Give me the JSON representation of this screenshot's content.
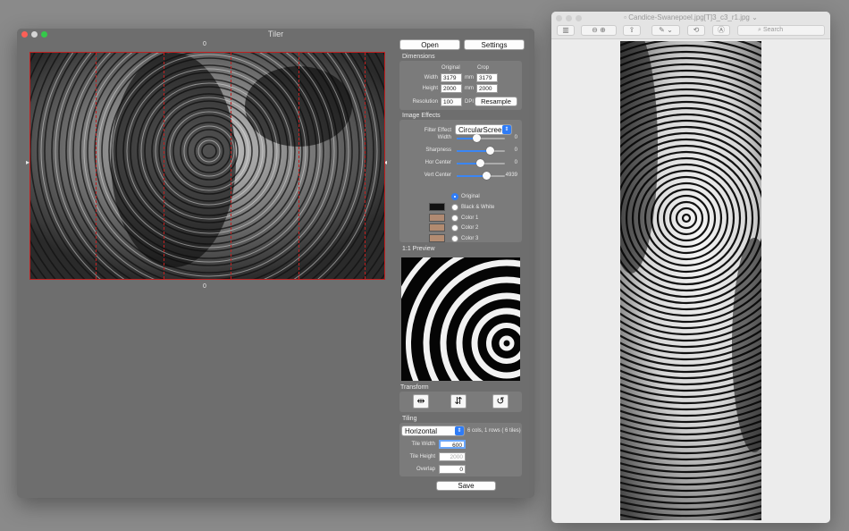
{
  "tiler": {
    "title": "Tiler",
    "ruler_top": "0",
    "ruler_bottom": "0",
    "open_label": "Open",
    "settings_label": "Settings",
    "dimensions": {
      "title": "Dimensions",
      "col_original": "Original",
      "col_crop": "Crop",
      "width_label": "Width",
      "height_label": "Height",
      "resolution_label": "Resolution",
      "orig_width": "3179",
      "orig_height": "2000",
      "crop_width": "3179",
      "crop_height": "2000",
      "unit_mm": "mm",
      "resolution": "100",
      "unit_dpi": "DPI",
      "resample_label": "Resample"
    },
    "effects": {
      "title": "Image Effects",
      "filter_label": "Filter Effect",
      "filter_value": "CircularScreen",
      "sliders": [
        {
          "label": "Width",
          "value": "0",
          "fraction": 0.4
        },
        {
          "label": "Sharpness",
          "value": "0",
          "fraction": 0.68
        },
        {
          "label": "Hor Center",
          "value": "0",
          "fraction": 0.48
        },
        {
          "label": "Vert Center",
          "value": "4939",
          "fraction": 0.62
        }
      ],
      "options": [
        {
          "label": "Original",
          "selected": true
        },
        {
          "label": "Black & White",
          "selected": false
        },
        {
          "label": "Color 1",
          "selected": false
        },
        {
          "label": "Color 2",
          "selected": false
        },
        {
          "label": "Color 3",
          "selected": false
        }
      ],
      "swatch_colors": [
        "#111111",
        "#b08a72",
        "#b28b70",
        "#b38c72"
      ]
    },
    "preview_title": "1:1 Preview",
    "transform_title": "Transform",
    "tiling": {
      "title": "Tiling",
      "mode": "Horizontal",
      "summary": "6 cols, 1 rows ( 6 tiles)",
      "tile_width_label": "Tile Width",
      "tile_width": "600",
      "tile_height_label": "Tile Height",
      "tile_height": "2000",
      "overlap_label": "Overlap",
      "overlap": "0"
    },
    "save_label": "Save"
  },
  "preview_app": {
    "title": "Candice-Swanepoel.jpg[T]3_c3_r1.jpg",
    "search_placeholder": "Search"
  },
  "colors": {
    "accent": "#2f7cf6",
    "tile_line": "#c02020",
    "window_bg": "#6e6e6e"
  }
}
